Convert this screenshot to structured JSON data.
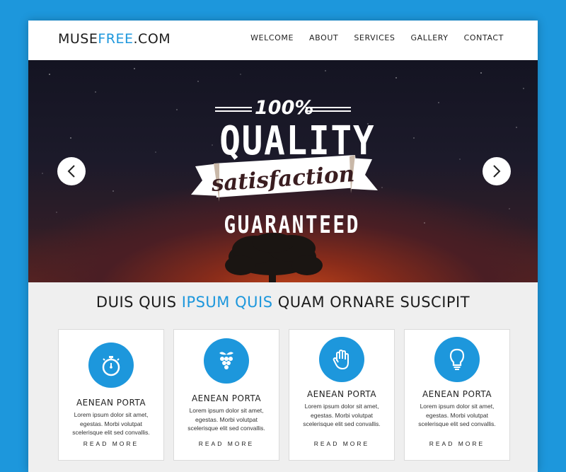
{
  "header": {
    "logo_main": "MUSE",
    "logo_accent": "FREE",
    "logo_suffix": ".COM",
    "nav": [
      "WELCOME",
      "ABOUT",
      "SERVICES",
      "GALLERY",
      "CONTACT"
    ]
  },
  "hero": {
    "line1": "100%",
    "line2": "QUALITY",
    "line3": "satisfaction",
    "line4": "GUARANTEED",
    "prev_icon": "chevron-left-icon",
    "next_icon": "chevron-right-icon"
  },
  "section": {
    "title_start": "DUIS QUIS ",
    "title_accent": "IPSUM QUIS",
    "title_end": " QUAM ORNARE SUSCIPIT"
  },
  "cards": [
    {
      "icon": "stopwatch-icon",
      "title": "AENEAN PORTA",
      "text": "Lorem ipsum dolor sit amet, egestas. Morbi volutpat scelerisque elit sed convallis.",
      "more": "READ MORE"
    },
    {
      "icon": "grapes-icon",
      "title": "AENEAN PORTA",
      "text": "Lorem ipsum dolor sit amet, egestas. Morbi volutpat scelerisque elit sed convallis.",
      "more": "READ MORE"
    },
    {
      "icon": "hand-icon",
      "title": "AENEAN PORTA",
      "text": "Lorem ipsum dolor sit amet, egestas. Morbi volutpat scelerisque elit sed convallis.",
      "more": "READ MORE"
    },
    {
      "icon": "lightbulb-icon",
      "title": "AENEAN PORTA",
      "text": "Lorem ipsum dolor sit amet, egestas. Morbi volutpat scelerisque elit sed convallis.",
      "more": "READ MORE"
    }
  ],
  "colors": {
    "accent": "#1d97dc",
    "background": "#1d97dc",
    "text": "#1c1c1c"
  }
}
